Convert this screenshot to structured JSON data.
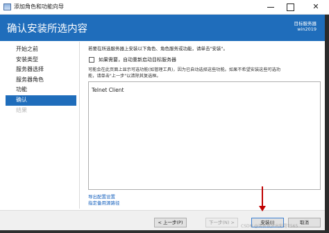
{
  "window": {
    "title": "添加角色和功能向导",
    "minimize": "",
    "maximize": "",
    "close": "✕"
  },
  "header": {
    "page_title": "确认安装所选内容",
    "destination_label": "目标服务器",
    "destination_server": "win2019"
  },
  "nav": {
    "items": [
      {
        "label": "开始之前",
        "state": "normal"
      },
      {
        "label": "安装类型",
        "state": "normal"
      },
      {
        "label": "服务器选择",
        "state": "normal"
      },
      {
        "label": "服务器角色",
        "state": "normal"
      },
      {
        "label": "功能",
        "state": "normal"
      },
      {
        "label": "确认",
        "state": "active"
      },
      {
        "label": "结果",
        "state": "disabled"
      }
    ]
  },
  "main": {
    "intro": "若要在所选服务器上安装以下角色、角色服务或功能，请单击\"安装\"。",
    "restart_checkbox_label": "如果需要，自动重新启动目标服务器",
    "restart_checked": false,
    "info_line1": "可能会在此页面上显示可选功能(如管理工具)，因为已自动选择这些功能。如果不希望安装这些可选功",
    "info_line2": "能，请单击\"上一步\"以清除其复选框。",
    "features": [
      "Telnet Client"
    ],
    "export_link": "导出配置设置",
    "alt_source_link": "指定备用源路径"
  },
  "footer": {
    "prev": "< 上一步(P)",
    "next": "下一步(N) >",
    "install": "安装(I)",
    "cancel": "取消"
  },
  "watermark": "CSDN @清新夜梦出彩霜7565",
  "colors": {
    "accent": "#1f6dbb",
    "link": "#1560bd",
    "annotation": "#c00000"
  }
}
